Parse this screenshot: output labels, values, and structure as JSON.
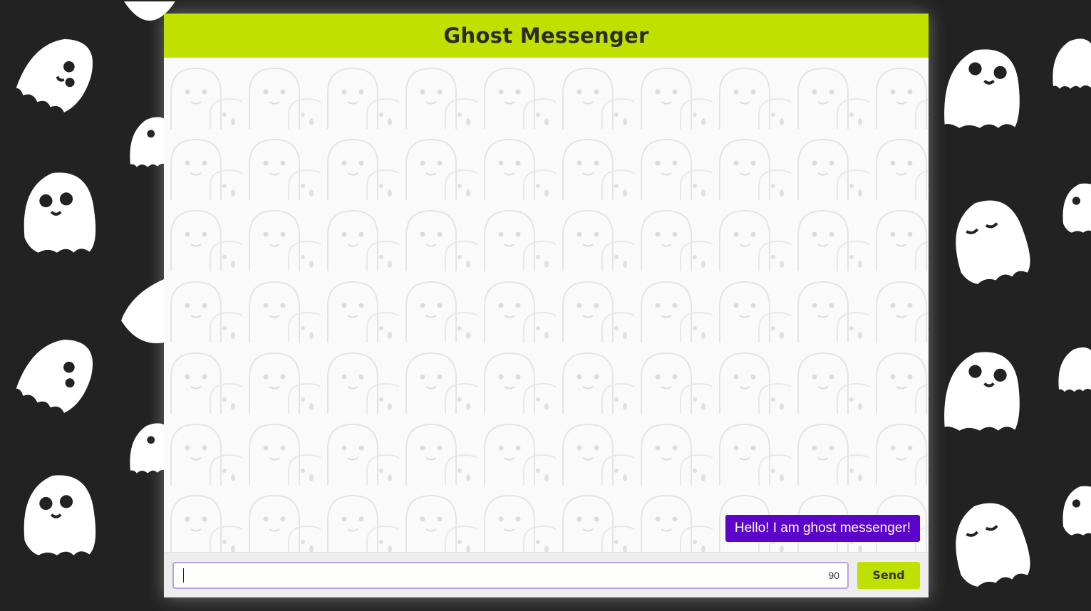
{
  "app": {
    "title": "Ghost Messenger"
  },
  "messages": [
    {
      "text": "Hello! I am ghost messenger!",
      "align": "right"
    }
  ],
  "composer": {
    "input_value": "",
    "placeholder": "",
    "char_counter": "90",
    "send_label": "Send"
  },
  "colors": {
    "header_bg": "#c0e000",
    "bubble_bg": "#5c04c9",
    "page_bg": "#222222",
    "input_border": "#b8a2d8"
  },
  "icons": {
    "background": "ghost-icon"
  }
}
